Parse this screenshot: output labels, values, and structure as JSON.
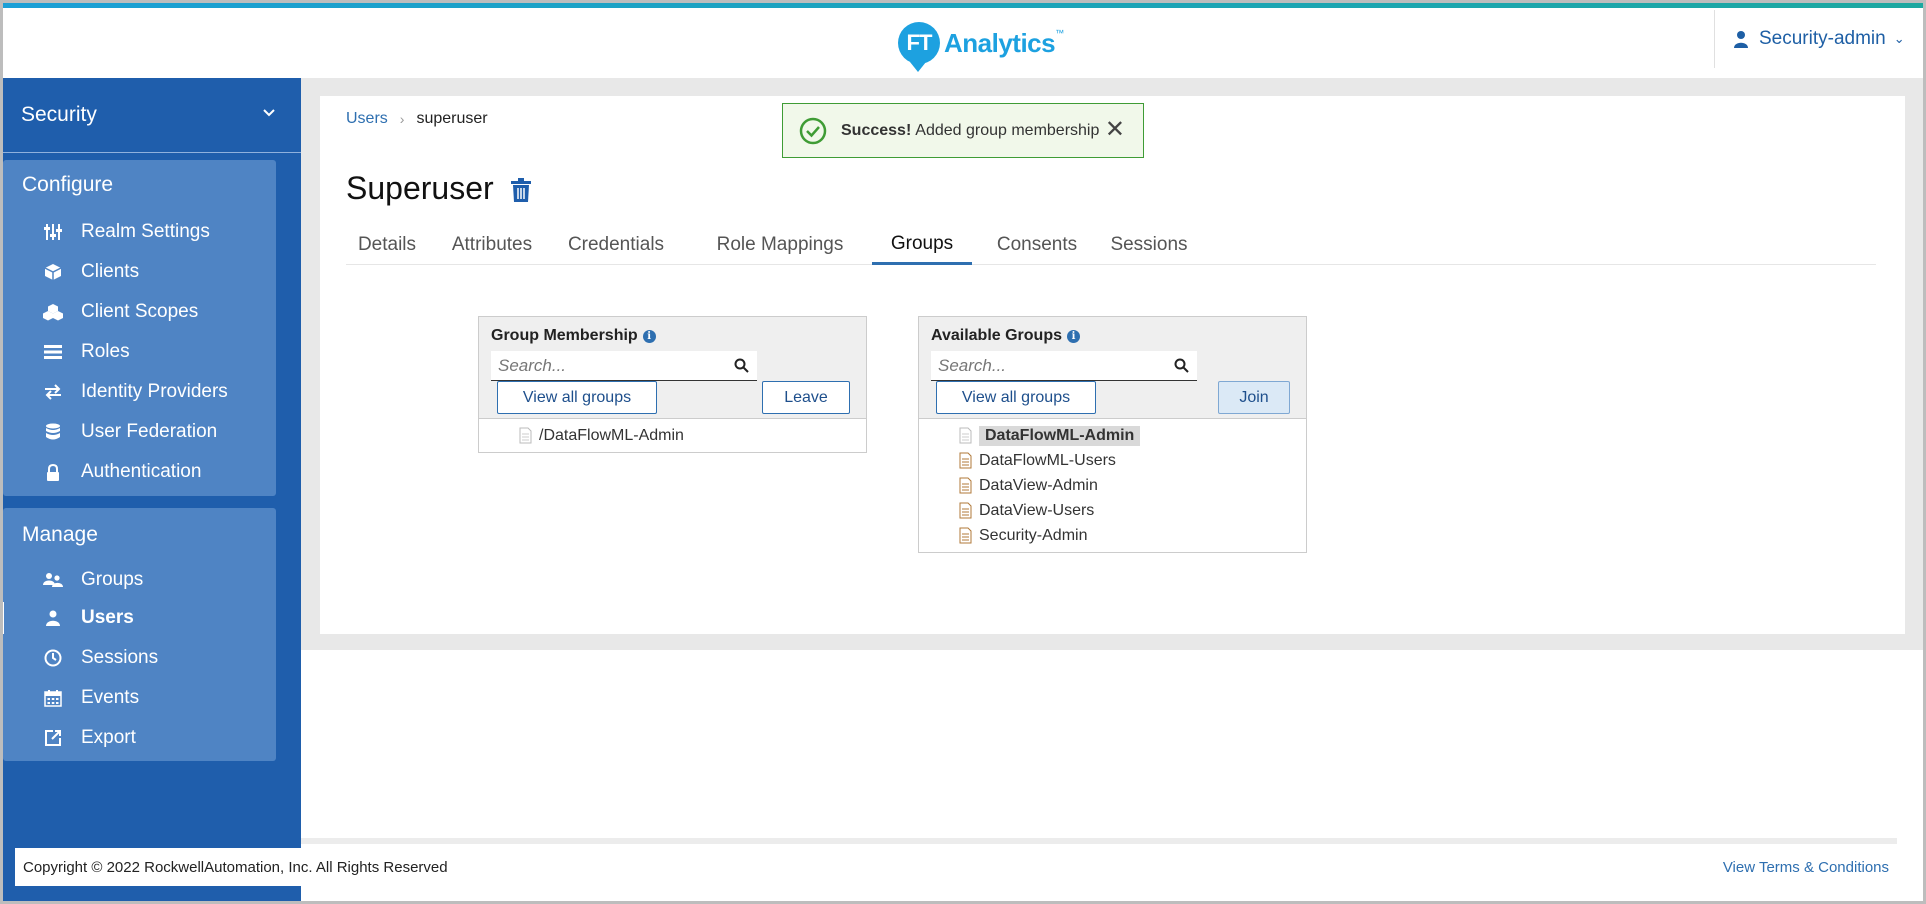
{
  "header": {
    "logo_badge": "FT",
    "logo_text": "Analytics",
    "logo_tm": "™",
    "user_name": "Security-admin"
  },
  "sidebar": {
    "realm": "Security",
    "configure_title": "Configure",
    "configure_items": [
      {
        "label": "Realm Settings",
        "icon": "sliders-icon"
      },
      {
        "label": "Clients",
        "icon": "cube-icon"
      },
      {
        "label": "Client Scopes",
        "icon": "cubes-icon"
      },
      {
        "label": "Roles",
        "icon": "list-icon"
      },
      {
        "label": "Identity Providers",
        "icon": "exchange-icon"
      },
      {
        "label": "User Federation",
        "icon": "database-icon"
      },
      {
        "label": "Authentication",
        "icon": "lock-icon"
      }
    ],
    "manage_title": "Manage",
    "manage_items": [
      {
        "label": "Groups",
        "icon": "users-icon"
      },
      {
        "label": "Users",
        "icon": "user-icon",
        "active": true
      },
      {
        "label": "Sessions",
        "icon": "clock-icon"
      },
      {
        "label": "Events",
        "icon": "calendar-icon"
      },
      {
        "label": "Export",
        "icon": "export-icon"
      }
    ]
  },
  "breadcrumb": {
    "parent": "Users",
    "current": "superuser"
  },
  "alert": {
    "strong": "Success!",
    "message": "Added group membership",
    "close": "✕"
  },
  "page_title": "Superuser",
  "tabs": [
    "Details",
    "Attributes",
    "Credentials",
    "Role Mappings",
    "Groups",
    "Consents",
    "Sessions"
  ],
  "active_tab": "Groups",
  "group_membership": {
    "title": "Group Membership",
    "search_placeholder": "Search...",
    "view_all_label": "View all groups",
    "leave_label": "Leave",
    "items": [
      "/DataFlowML-Admin"
    ]
  },
  "available_groups": {
    "title": "Available Groups",
    "search_placeholder": "Search...",
    "view_all_label": "View all groups",
    "join_label": "Join",
    "items": [
      "DataFlowML-Admin",
      "DataFlowML-Users",
      "DataView-Admin",
      "DataView-Users",
      "Security-Admin"
    ],
    "selected": "DataFlowML-Admin"
  },
  "footer": {
    "copyright": "Copyright © 2022 RockwellAutomation, Inc. All Rights Reserved",
    "terms": "View Terms & Conditions"
  },
  "colors": {
    "accent": "#1f5eac",
    "nav_group": "#4f84c4",
    "logo": "#1da1e0",
    "success": "#3f9c35"
  }
}
